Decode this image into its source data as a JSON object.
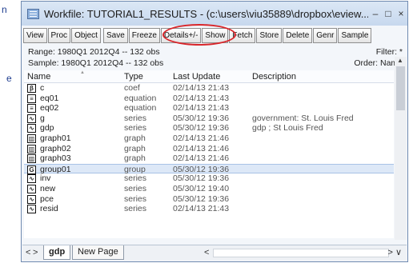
{
  "left_fragments": [
    "n",
    "e"
  ],
  "window": {
    "title": "Workfile: TUTORIAL1_RESULTS - (c:\\users\\viu35889\\dropbox\\eview...",
    "minimize": "–",
    "maximize": "□",
    "close": "×"
  },
  "toolbar": {
    "view": "View",
    "proc": "Proc",
    "object": "Object",
    "save": "Save",
    "freeze": "Freeze",
    "details": "Details+/-",
    "show": "Show",
    "fetch": "Fetch",
    "store": "Store",
    "delete": "Delete",
    "genr": "Genr",
    "sample": "Sample"
  },
  "info": {
    "range": "Range:  1980Q1 2012Q4  --  132 obs",
    "sample": "Sample: 1980Q1 2012Q4  --  132 obs",
    "filter": "Filter: *",
    "order": "Order: Name"
  },
  "columns": {
    "name": "Name",
    "type": "Type",
    "last_update": "Last Update",
    "description": "Description"
  },
  "rows": [
    {
      "icon": "β",
      "name": "c",
      "type": "coef",
      "updated": "02/14/13  21:43",
      "desc": ""
    },
    {
      "icon": "≡",
      "name": "eq01",
      "type": "equation",
      "updated": "02/14/13  21:43",
      "desc": ""
    },
    {
      "icon": "≡",
      "name": "eq02",
      "type": "equation",
      "updated": "02/14/13  21:43",
      "desc": ""
    },
    {
      "icon": "∿",
      "name": "g",
      "type": "series",
      "updated": "05/30/12  19:36",
      "desc": "government: St. Louis Fred"
    },
    {
      "icon": "∿",
      "name": "gdp",
      "type": "series",
      "updated": "05/30/12  19:36",
      "desc": "gdp ; St Louis Fred"
    },
    {
      "icon": "▥",
      "name": "graph01",
      "type": "graph",
      "updated": "02/14/13  21:46",
      "desc": ""
    },
    {
      "icon": "▥",
      "name": "graph02",
      "type": "graph",
      "updated": "02/14/13  21:46",
      "desc": ""
    },
    {
      "icon": "▥",
      "name": "graph03",
      "type": "graph",
      "updated": "02/14/13  21:46",
      "desc": ""
    },
    {
      "icon": "G",
      "name": "group01",
      "type": "group",
      "updated": "05/30/12  19:36",
      "desc": ""
    },
    {
      "icon": "∿",
      "name": "inv",
      "type": "series",
      "updated": "05/30/12  19:36",
      "desc": ""
    },
    {
      "icon": "∿",
      "name": "new",
      "type": "series",
      "updated": "05/30/12  19:40",
      "desc": ""
    },
    {
      "icon": "∿",
      "name": "pce",
      "type": "series",
      "updated": "05/30/12  19:36",
      "desc": ""
    },
    {
      "icon": "∿",
      "name": "resid",
      "type": "series",
      "updated": "02/14/13  21:43",
      "desc": ""
    }
  ],
  "selected_row": "group01",
  "tabs": {
    "active": "gdp",
    "new_page": "New Page"
  },
  "nav": {
    "left": "<",
    "right": ">",
    "hleft": "<",
    "hright": ">  ∨"
  }
}
